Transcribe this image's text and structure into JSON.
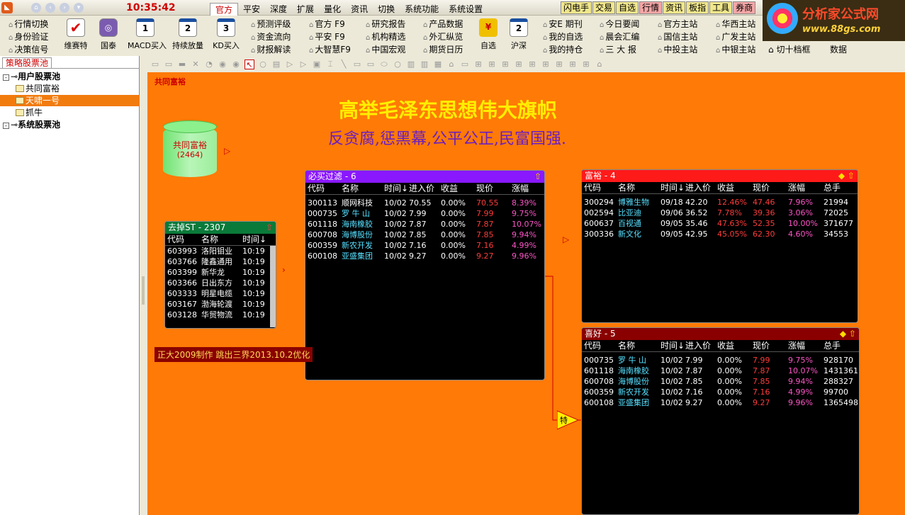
{
  "topbar": {
    "clock": "10:35:42",
    "menu": [
      "官方",
      "平安",
      "深度",
      "扩展",
      "量化",
      "资讯",
      "切换",
      "系统功能",
      "系统设置"
    ],
    "quick": [
      "闪电手",
      "交易",
      "自选",
      "行情",
      "资讯",
      "板指",
      "工具",
      "券商"
    ]
  },
  "brand": {
    "name": "分析家公式网",
    "url": "www.88gs.com"
  },
  "toolbar": {
    "col1": [
      "行情切换",
      "身份验证",
      "决策信号"
    ],
    "big1": [
      "维赛特",
      "国泰",
      "MACD买入",
      "持续放量",
      "KD买入"
    ],
    "big1_icons": [
      "✔",
      "◎",
      "1",
      "2",
      "3"
    ],
    "col2": [
      "预测评级",
      "资金流向",
      "财报解读"
    ],
    "col3": [
      "官方  F9",
      "平安  F9",
      "大智慧F9"
    ],
    "col4": [
      "研究报告",
      "机构精选",
      "中国宏观"
    ],
    "col5": [
      "产品数据",
      "外汇纵览",
      "期货日历"
    ],
    "big2": [
      "自选",
      "沪深"
    ],
    "big2_icons": [
      "¥",
      "2"
    ],
    "col6": [
      "安E 期刊",
      "我的自选",
      "我的持仓"
    ],
    "col7": [
      "今日要闻",
      "晨会汇编",
      "三 大 报"
    ],
    "col8": [
      "官方主站",
      "国信主站",
      "中投主站"
    ],
    "col9": [
      "华西主站",
      "广发主站",
      "中银主站"
    ],
    "col10": [
      "切十档框"
    ],
    "col11": [
      "数据"
    ]
  },
  "left": {
    "tab": "策略股票池",
    "tree": [
      {
        "label": "用户股票池",
        "level": 0,
        "expander": "-"
      },
      {
        "label": "共同富裕",
        "level": 1
      },
      {
        "label": "天啸一号",
        "level": 1,
        "selected": true
      },
      {
        "label": "抓牛",
        "level": 1
      },
      {
        "label": "系统股票池",
        "level": 0,
        "expander": "-"
      }
    ]
  },
  "canvas": {
    "label": "共同富裕",
    "headline": "高举毛泽东思想伟大旗帜",
    "slogan": "反贪腐,惩黑幕,公平公正,民富国强.",
    "pool_title": "共同富裕",
    "pool_count": "(2464)",
    "footer_note": "正大2009制作 跳出三界2013.10.2优化",
    "special_node": "特"
  },
  "windows": {
    "exclude_st": {
      "title": "去掉ST - 2307",
      "headers": [
        "代码",
        "名称",
        "时间↓"
      ],
      "rows": [
        [
          "603993",
          "洛阳钼业",
          "10:19"
        ],
        [
          "603766",
          "隆鑫通用",
          "10:19"
        ],
        [
          "603399",
          "新华龙",
          "10:19"
        ],
        [
          "603366",
          "日出东方",
          "10:19"
        ],
        [
          "603333",
          "明星电缆",
          "10:19"
        ],
        [
          "603167",
          "渤海轮渡",
          "10:19"
        ],
        [
          "603128",
          "华贸物流",
          "10:19"
        ]
      ]
    },
    "must_buy": {
      "title": "必买过滤 - 6",
      "headers": [
        "代码",
        "名称",
        "时间↓",
        "进入价",
        "收益",
        "现价",
        "涨幅"
      ],
      "rows": [
        [
          "300113",
          "顺网科技",
          "10/02",
          "70.55",
          "0.00%",
          "70.55",
          "8.39%"
        ],
        [
          "000735",
          "罗 牛 山",
          "10/02",
          "7.99",
          "0.00%",
          "7.99",
          "9.75%"
        ],
        [
          "601118",
          "海南橡胶",
          "10/02",
          "7.87",
          "0.00%",
          "7.87",
          "10.07%"
        ],
        [
          "600708",
          "海博股份",
          "10/02",
          "7.85",
          "0.00%",
          "7.85",
          "9.94%"
        ],
        [
          "600359",
          "新农开发",
          "10/02",
          "7.16",
          "0.00%",
          "7.16",
          "4.99%"
        ],
        [
          "600108",
          "亚盛集团",
          "10/02",
          "9.27",
          "0.00%",
          "9.27",
          "9.96%"
        ]
      ]
    },
    "rich": {
      "title": "富裕 - 4",
      "headers": [
        "代码",
        "名称",
        "时间↓",
        "进入价",
        "收益",
        "现价",
        "涨幅",
        "总手"
      ],
      "rows": [
        [
          "300294",
          "博雅生物",
          "09/18",
          "42.20",
          "12.46%",
          "47.46",
          "7.96%",
          "21994"
        ],
        [
          "002594",
          "比亚迪",
          "09/06",
          "36.52",
          "7.78%",
          "39.36",
          "3.06%",
          "72025"
        ],
        [
          "600637",
          "百视通",
          "09/05",
          "35.46",
          "47.63%",
          "52.35",
          "10.00%",
          "371677"
        ],
        [
          "300336",
          "新文化",
          "09/05",
          "42.95",
          "45.05%",
          "62.30",
          "4.60%",
          "34553"
        ]
      ]
    },
    "good": {
      "title": "喜好 - 5",
      "headers": [
        "代码",
        "名称",
        "时间↓",
        "进入价",
        "收益",
        "现价",
        "涨幅",
        "总手"
      ],
      "rows": [
        [
          "000735",
          "罗 牛 山",
          "10/02",
          "7.99",
          "0.00%",
          "7.99",
          "9.75%",
          "928170"
        ],
        [
          "601118",
          "海南橡胶",
          "10/02",
          "7.87",
          "0.00%",
          "7.87",
          "10.07%",
          "1431361"
        ],
        [
          "600708",
          "海博股份",
          "10/02",
          "7.85",
          "0.00%",
          "7.85",
          "9.94%",
          "288327"
        ],
        [
          "600359",
          "新农开发",
          "10/02",
          "7.16",
          "0.00%",
          "7.16",
          "4.99%",
          "99700"
        ],
        [
          "600108",
          "亚盛集团",
          "10/02",
          "9.27",
          "0.00%",
          "9.27",
          "9.96%",
          "1365498"
        ]
      ]
    }
  },
  "colors": {
    "canvas_bg": "#ff7a06",
    "must_buy_title": "#8a18ff",
    "rich_title": "#ff1a1a",
    "good_title": "#8a0000",
    "exclude_title": "#0a7a3a"
  }
}
